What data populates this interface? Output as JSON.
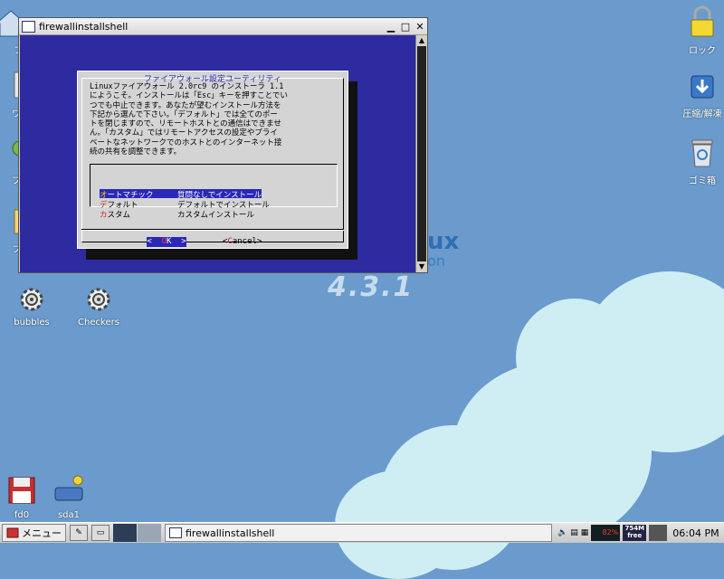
{
  "desktop": {
    "brand_fragment_1": "ux",
    "brand_fragment_2": "on",
    "version": "4.3.1",
    "icons_left": [
      {
        "label": "bubbles"
      },
      {
        "label": "Checkers"
      },
      {
        "label": "fd0"
      },
      {
        "label": "sda1"
      }
    ],
    "icons_left_partial": [
      "フ",
      "ワ",
      "プ",
      "フ"
    ],
    "icons_right": [
      {
        "label": "ロック"
      },
      {
        "label": "圧縮/解凍"
      },
      {
        "label": "ゴミ箱"
      }
    ]
  },
  "window": {
    "title": "firewallinstallshell",
    "controls": {
      "minimize": "▁",
      "maximize": "□",
      "close": "✕"
    }
  },
  "dialog": {
    "title": "ファイアウォール設定ユーティリティ",
    "body": "Linuxファイアウォール 2.0rc9 のインストーラ 1.1\nにようこそ。インストールは「Esc」キーを押すことでい\nつでも中止できます。あなたが望むインストール方法を\n下記から選んで下さい。「デフォルト」では全てのポー\nトを閉じますので、リモートホストとの通信はできませ\nん。「カスタム」ではリモートアクセスの設定やプライ\nベートなネットワークでのホストとのインターネット接\n続の共有を調整できます。",
    "options": [
      {
        "hotkey": "オ",
        "tag_rest": "ートマチック",
        "desc": "質問なしでインストール",
        "selected": true
      },
      {
        "hotkey": "デ",
        "tag_rest": "フォルト",
        "desc": "デフォルトでインストール",
        "selected": false
      },
      {
        "hotkey": "カ",
        "tag_rest": "スタム",
        "desc": "カスタムインストール",
        "selected": false
      }
    ],
    "ok_left": "<  ",
    "ok_hotkey": "O",
    "ok_rest": "K  >",
    "cancel_left": "<",
    "cancel_hotkey": "C",
    "cancel_rest": "ancel>"
  },
  "taskbar": {
    "menu_label": "メニュー",
    "task_title": "firewallinstallshell",
    "cpu": "82%",
    "mem_line1": "754M",
    "mem_line2": "free",
    "clock": "06:04 PM"
  }
}
